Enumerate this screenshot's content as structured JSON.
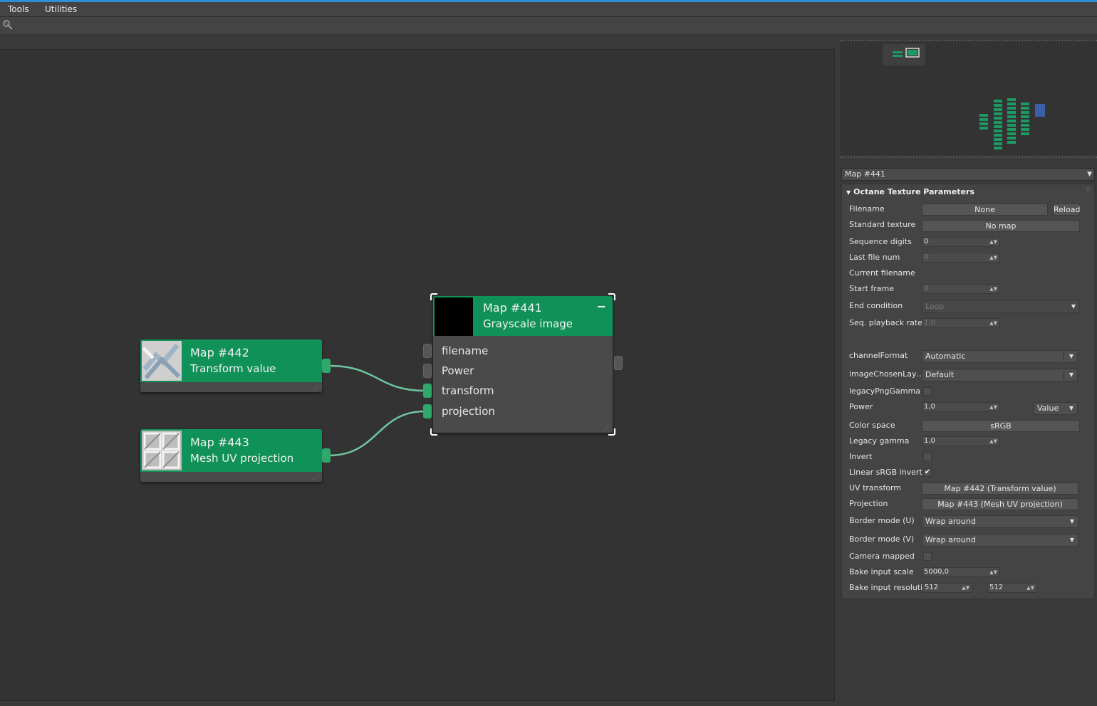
{
  "menu": {
    "tools": "Tools",
    "utilities": "Utilities"
  },
  "colors": {
    "accent": "#2d8fd6",
    "node_header": "#0f9158",
    "port": "#2fa86c",
    "wire": "#6fc6a0"
  },
  "nodes": {
    "map442": {
      "title": "Map #442",
      "subtitle": "Transform value"
    },
    "map443": {
      "title": "Map #443",
      "subtitle": "Mesh UV projection"
    },
    "map441": {
      "title": "Map #441",
      "subtitle": "Grayscale image",
      "params": [
        "filename",
        "Power",
        "transform",
        "projection"
      ]
    }
  },
  "panel": {
    "map_select": "Map #441",
    "rollout_title": "Octane Texture Parameters",
    "filename": {
      "label": "Filename",
      "value": "None",
      "reload": "Reload"
    },
    "standard_texture": {
      "label": "Standard texture",
      "value": "No map"
    },
    "sequence_digits": {
      "label": "Sequence digits",
      "value": "0"
    },
    "last_file_num": {
      "label": "Last file num",
      "value": "0"
    },
    "current_filename": {
      "label": "Current filename"
    },
    "start_frame": {
      "label": "Start frame",
      "value": "0"
    },
    "end_condition": {
      "label": "End condition",
      "value": "Loop"
    },
    "seq_playback_rate": {
      "label": "Seq. playback rate",
      "value": "1,0"
    },
    "channel_format": {
      "label": "channelFormat",
      "value": "Automatic"
    },
    "image_chosen_layer": {
      "label": "imageChosenLaye...",
      "value": "Default"
    },
    "legacy_png_gamma": {
      "label": "legacyPngGamma",
      "checked": false
    },
    "power": {
      "label": "Power",
      "value": "1,0",
      "mode": "Value"
    },
    "color_space": {
      "label": "Color space",
      "value": "sRGB"
    },
    "legacy_gamma": {
      "label": "Legacy gamma",
      "value": "1,0"
    },
    "invert": {
      "label": "Invert",
      "checked": false
    },
    "linear_srgb_invert": {
      "label": "Linear sRGB invert",
      "checked": true,
      "mark": "✔"
    },
    "uv_transform": {
      "label": "UV transform",
      "value": "Map #442 (Transform value)"
    },
    "projection": {
      "label": "Projection",
      "value": "Map #443 (Mesh UV projection)"
    },
    "border_mode_u": {
      "label": "Border mode (U)",
      "value": "Wrap around"
    },
    "border_mode_v": {
      "label": "Border mode (V)",
      "value": "Wrap around"
    },
    "camera_mapped": {
      "label": "Camera mapped",
      "checked": false
    },
    "bake_input_scale": {
      "label": "Bake input scale",
      "value": "5000,0"
    },
    "bake_input_resolution": {
      "label": "Bake input resolution",
      "value_x": "512",
      "value_y": "512"
    }
  }
}
